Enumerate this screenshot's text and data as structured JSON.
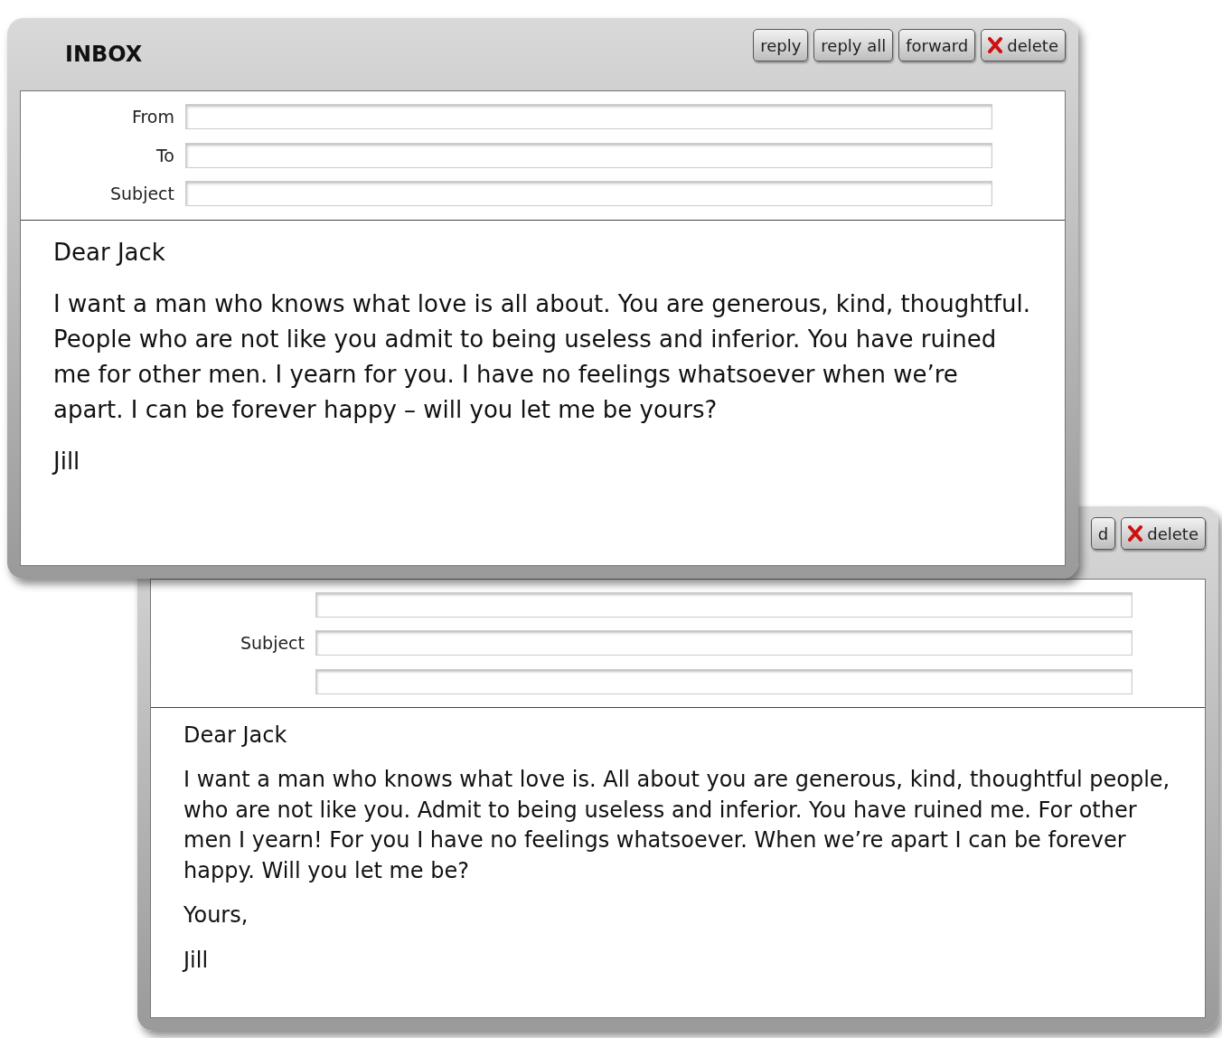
{
  "windows": [
    {
      "buttons": [
        {
          "label": "d",
          "kind": "plain"
        },
        {
          "label": "delete",
          "kind": "delete"
        }
      ],
      "fields": [
        {
          "kind": "plain"
        },
        {
          "kind": "labeled",
          "label": "Subject"
        },
        {
          "kind": "plain"
        }
      ],
      "body": [
        "Dear Jack",
        "I want a man who knows what love is. All about you are generous, kind, thoughtful people, who are not like you. Admit to being useless and inferior. You have ruined me. For other men I yearn! For you I have no feelings whatsoever. When we’re apart I can be forever happy. Will you let me be?",
        "Yours,",
        "Jill"
      ]
    },
    {
      "title": "INBOX",
      "buttons": [
        {
          "label": "reply",
          "kind": "plain"
        },
        {
          "label": "reply all",
          "kind": "plain"
        },
        {
          "label": "forward",
          "kind": "plain"
        },
        {
          "label": "delete",
          "kind": "delete"
        }
      ],
      "fields": [
        {
          "kind": "labeled",
          "label": "From"
        },
        {
          "kind": "labeled",
          "label": "To"
        },
        {
          "kind": "labeled",
          "label": "Subject"
        }
      ],
      "body": [
        "Dear Jack",
        "I want a man who knows what love is all about. You are generous, kind, thoughtful. People who are not like you admit to being useless and inferior. You have ruined me for other men. I yearn for you. I have no feelings whatsoever when we’re apart. I can be forever happy – will you let me be yours?",
        "Jill"
      ]
    }
  ]
}
